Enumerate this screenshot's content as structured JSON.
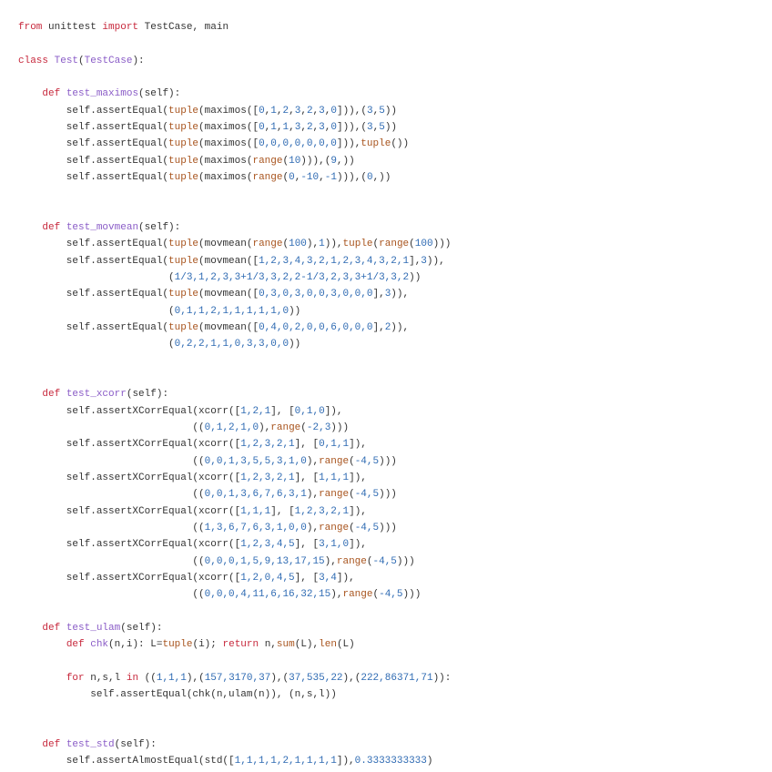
{
  "colors": {
    "keyword": "#c7283c",
    "function": "#8a5cc7",
    "builtin": "#a8541e",
    "number": "#2f6bb3",
    "text": "#333333"
  },
  "code_lines": [
    [
      [
        "k",
        "from"
      ],
      [
        "t",
        " unittest "
      ],
      [
        "k",
        "import"
      ],
      [
        "t",
        " TestCase, main"
      ]
    ],
    [],
    [
      [
        "k",
        "class"
      ],
      [
        "t",
        " "
      ],
      [
        "f",
        "Test"
      ],
      [
        "t",
        "("
      ],
      [
        "f",
        "TestCase"
      ],
      [
        "t",
        "):"
      ]
    ],
    [],
    [
      [
        "t",
        "    "
      ],
      [
        "k",
        "def"
      ],
      [
        "t",
        " "
      ],
      [
        "f",
        "test_maximos"
      ],
      [
        "t",
        "(self):"
      ]
    ],
    [
      [
        "t",
        "        self.assertEqual("
      ],
      [
        "b",
        "tuple"
      ],
      [
        "t",
        "(maximos(["
      ],
      [
        "n",
        "0"
      ],
      [
        "t",
        ","
      ],
      [
        "n",
        "1"
      ],
      [
        "t",
        ","
      ],
      [
        "n",
        "2"
      ],
      [
        "t",
        ","
      ],
      [
        "n",
        "3"
      ],
      [
        "t",
        ","
      ],
      [
        "n",
        "2"
      ],
      [
        "t",
        ","
      ],
      [
        "n",
        "3"
      ],
      [
        "t",
        ","
      ],
      [
        "n",
        "0"
      ],
      [
        "t",
        "])),("
      ],
      [
        "n",
        "3"
      ],
      [
        "t",
        ","
      ],
      [
        "n",
        "5"
      ],
      [
        "t",
        "))"
      ]
    ],
    [
      [
        "t",
        "        self.assertEqual("
      ],
      [
        "b",
        "tuple"
      ],
      [
        "t",
        "(maximos(["
      ],
      [
        "n",
        "0"
      ],
      [
        "t",
        ","
      ],
      [
        "n",
        "1"
      ],
      [
        "t",
        ","
      ],
      [
        "n",
        "1"
      ],
      [
        "t",
        ","
      ],
      [
        "n",
        "3"
      ],
      [
        "t",
        ","
      ],
      [
        "n",
        "2"
      ],
      [
        "t",
        ","
      ],
      [
        "n",
        "3"
      ],
      [
        "t",
        ","
      ],
      [
        "n",
        "0"
      ],
      [
        "t",
        "])),("
      ],
      [
        "n",
        "3"
      ],
      [
        "t",
        ","
      ],
      [
        "n",
        "5"
      ],
      [
        "t",
        "))"
      ]
    ],
    [
      [
        "t",
        "        self.assertEqual("
      ],
      [
        "b",
        "tuple"
      ],
      [
        "t",
        "(maximos(["
      ],
      [
        "n",
        "0,0,0,0,0,0,0"
      ],
      [
        "t",
        "])),"
      ],
      [
        "b",
        "tuple"
      ],
      [
        "t",
        "())"
      ]
    ],
    [
      [
        "t",
        "        self.assertEqual("
      ],
      [
        "b",
        "tuple"
      ],
      [
        "t",
        "(maximos("
      ],
      [
        "b",
        "range"
      ],
      [
        "t",
        "("
      ],
      [
        "n",
        "10"
      ],
      [
        "t",
        "))),("
      ],
      [
        "n",
        "9"
      ],
      [
        "t",
        ",))"
      ]
    ],
    [
      [
        "t",
        "        self.assertEqual("
      ],
      [
        "b",
        "tuple"
      ],
      [
        "t",
        "(maximos("
      ],
      [
        "b",
        "range"
      ],
      [
        "t",
        "("
      ],
      [
        "n",
        "0"
      ],
      [
        "t",
        ","
      ],
      [
        "n",
        "-10"
      ],
      [
        "t",
        ","
      ],
      [
        "n",
        "-1"
      ],
      [
        "t",
        "))),("
      ],
      [
        "n",
        "0"
      ],
      [
        "t",
        ",))"
      ]
    ],
    [],
    [],
    [
      [
        "t",
        "    "
      ],
      [
        "k",
        "def"
      ],
      [
        "t",
        " "
      ],
      [
        "f",
        "test_movmean"
      ],
      [
        "t",
        "(self):"
      ]
    ],
    [
      [
        "t",
        "        self.assertEqual("
      ],
      [
        "b",
        "tuple"
      ],
      [
        "t",
        "(movmean("
      ],
      [
        "b",
        "range"
      ],
      [
        "t",
        "("
      ],
      [
        "n",
        "100"
      ],
      [
        "t",
        "),"
      ],
      [
        "n",
        "1"
      ],
      [
        "t",
        ")),"
      ],
      [
        "b",
        "tuple"
      ],
      [
        "t",
        "("
      ],
      [
        "b",
        "range"
      ],
      [
        "t",
        "("
      ],
      [
        "n",
        "100"
      ],
      [
        "t",
        ")))"
      ]
    ],
    [
      [
        "t",
        "        self.assertEqual("
      ],
      [
        "b",
        "tuple"
      ],
      [
        "t",
        "(movmean(["
      ],
      [
        "n",
        "1,2,3,4,3,2,1,2,3,4,3,2,1"
      ],
      [
        "t",
        "],"
      ],
      [
        "n",
        "3"
      ],
      [
        "t",
        ")),"
      ]
    ],
    [
      [
        "t",
        "                         ("
      ],
      [
        "n",
        "1/3,1,2,3,3+1/3,3,2,2-1/3,2,3,3+1/3,3,2"
      ],
      [
        "t",
        "))"
      ]
    ],
    [
      [
        "t",
        "        self.assertEqual("
      ],
      [
        "b",
        "tuple"
      ],
      [
        "t",
        "(movmean(["
      ],
      [
        "n",
        "0,3,0,3,0,0,3,0,0,0"
      ],
      [
        "t",
        "],"
      ],
      [
        "n",
        "3"
      ],
      [
        "t",
        ")),"
      ]
    ],
    [
      [
        "t",
        "                         ("
      ],
      [
        "n",
        "0,1,1,2,1,1,1,1,1,0"
      ],
      [
        "t",
        "))"
      ]
    ],
    [
      [
        "t",
        "        self.assertEqual("
      ],
      [
        "b",
        "tuple"
      ],
      [
        "t",
        "(movmean(["
      ],
      [
        "n",
        "0,4,0,2,0,0,6,0,0,0"
      ],
      [
        "t",
        "],"
      ],
      [
        "n",
        "2"
      ],
      [
        "t",
        ")),"
      ]
    ],
    [
      [
        "t",
        "                         ("
      ],
      [
        "n",
        "0,2,2,1,1,0,3,3,0,0"
      ],
      [
        "t",
        "))"
      ]
    ],
    [],
    [],
    [
      [
        "t",
        "    "
      ],
      [
        "k",
        "def"
      ],
      [
        "t",
        " "
      ],
      [
        "f",
        "test_xcorr"
      ],
      [
        "t",
        "(self):"
      ]
    ],
    [
      [
        "t",
        "        self.assertXCorrEqual(xcorr(["
      ],
      [
        "n",
        "1,2,1"
      ],
      [
        "t",
        "], ["
      ],
      [
        "n",
        "0,1,0"
      ],
      [
        "t",
        "]),"
      ]
    ],
    [
      [
        "t",
        "                             (("
      ],
      [
        "n",
        "0,1,2,1,0"
      ],
      [
        "t",
        "),"
      ],
      [
        "b",
        "range"
      ],
      [
        "t",
        "("
      ],
      [
        "n",
        "-2,3"
      ],
      [
        "t",
        ")))"
      ]
    ],
    [
      [
        "t",
        "        self.assertXCorrEqual(xcorr(["
      ],
      [
        "n",
        "1,2,3,2,1"
      ],
      [
        "t",
        "], ["
      ],
      [
        "n",
        "0,1,1"
      ],
      [
        "t",
        "]),"
      ]
    ],
    [
      [
        "t",
        "                             (("
      ],
      [
        "n",
        "0,0,1,3,5,5,3,1,0"
      ],
      [
        "t",
        "),"
      ],
      [
        "b",
        "range"
      ],
      [
        "t",
        "("
      ],
      [
        "n",
        "-4,5"
      ],
      [
        "t",
        ")))"
      ]
    ],
    [
      [
        "t",
        "        self.assertXCorrEqual(xcorr(["
      ],
      [
        "n",
        "1,2,3,2,1"
      ],
      [
        "t",
        "], ["
      ],
      [
        "n",
        "1,1,1"
      ],
      [
        "t",
        "]),"
      ]
    ],
    [
      [
        "t",
        "                             (("
      ],
      [
        "n",
        "0,0,1,3,6,7,6,3,1"
      ],
      [
        "t",
        "),"
      ],
      [
        "b",
        "range"
      ],
      [
        "t",
        "("
      ],
      [
        "n",
        "-4,5"
      ],
      [
        "t",
        ")))"
      ]
    ],
    [
      [
        "t",
        "        self.assertXCorrEqual(xcorr(["
      ],
      [
        "n",
        "1,1,1"
      ],
      [
        "t",
        "], ["
      ],
      [
        "n",
        "1,2,3,2,1"
      ],
      [
        "t",
        "]),"
      ]
    ],
    [
      [
        "t",
        "                             (("
      ],
      [
        "n",
        "1,3,6,7,6,3,1,0,0"
      ],
      [
        "t",
        "),"
      ],
      [
        "b",
        "range"
      ],
      [
        "t",
        "("
      ],
      [
        "n",
        "-4,5"
      ],
      [
        "t",
        ")))"
      ]
    ],
    [
      [
        "t",
        "        self.assertXCorrEqual(xcorr(["
      ],
      [
        "n",
        "1,2,3,4,5"
      ],
      [
        "t",
        "], ["
      ],
      [
        "n",
        "3,1,0"
      ],
      [
        "t",
        "]),"
      ]
    ],
    [
      [
        "t",
        "                             (("
      ],
      [
        "n",
        "0,0,0,1,5,9,13,17,15"
      ],
      [
        "t",
        "),"
      ],
      [
        "b",
        "range"
      ],
      [
        "t",
        "("
      ],
      [
        "n",
        "-4,5"
      ],
      [
        "t",
        ")))"
      ]
    ],
    [
      [
        "t",
        "        self.assertXCorrEqual(xcorr(["
      ],
      [
        "n",
        "1,2,0,4,5"
      ],
      [
        "t",
        "], ["
      ],
      [
        "n",
        "3,4"
      ],
      [
        "t",
        "]),"
      ]
    ],
    [
      [
        "t",
        "                             (("
      ],
      [
        "n",
        "0,0,0,4,11,6,16,32,15"
      ],
      [
        "t",
        "),"
      ],
      [
        "b",
        "range"
      ],
      [
        "t",
        "("
      ],
      [
        "n",
        "-4,5"
      ],
      [
        "t",
        ")))"
      ]
    ],
    [],
    [
      [
        "t",
        "    "
      ],
      [
        "k",
        "def"
      ],
      [
        "t",
        " "
      ],
      [
        "f",
        "test_ulam"
      ],
      [
        "t",
        "(self):"
      ]
    ],
    [
      [
        "t",
        "        "
      ],
      [
        "k",
        "def"
      ],
      [
        "t",
        " "
      ],
      [
        "f",
        "chk"
      ],
      [
        "t",
        "(n,i): L="
      ],
      [
        "b",
        "tuple"
      ],
      [
        "t",
        "(i); "
      ],
      [
        "k",
        "return"
      ],
      [
        "t",
        " n,"
      ],
      [
        "b",
        "sum"
      ],
      [
        "t",
        "(L),"
      ],
      [
        "b",
        "len"
      ],
      [
        "t",
        "(L)"
      ]
    ],
    [],
    [
      [
        "t",
        "        "
      ],
      [
        "k",
        "for"
      ],
      [
        "t",
        " n,s,l "
      ],
      [
        "k",
        "in"
      ],
      [
        "t",
        " (("
      ],
      [
        "n",
        "1,1,1"
      ],
      [
        "t",
        "),("
      ],
      [
        "n",
        "157,3170,37"
      ],
      [
        "t",
        "),("
      ],
      [
        "n",
        "37,535,22"
      ],
      [
        "t",
        "),("
      ],
      [
        "n",
        "222,86371,71"
      ],
      [
        "t",
        "))："
      ]
    ],
    [
      [
        "t",
        "            self.assertEqual(chk(n,ulam(n)), (n,s,l))"
      ]
    ],
    [],
    [],
    [
      [
        "t",
        "    "
      ],
      [
        "k",
        "def"
      ],
      [
        "t",
        " "
      ],
      [
        "f",
        "test_std"
      ],
      [
        "t",
        "(self):"
      ]
    ],
    [
      [
        "t",
        "        self.assertAlmostEqual(std(["
      ],
      [
        "n",
        "1,1,1,1,2,1,1,1,1"
      ],
      [
        "t",
        "]),"
      ],
      [
        "n",
        "0.3333333333"
      ],
      [
        "t",
        ")"
      ]
    ]
  ]
}
